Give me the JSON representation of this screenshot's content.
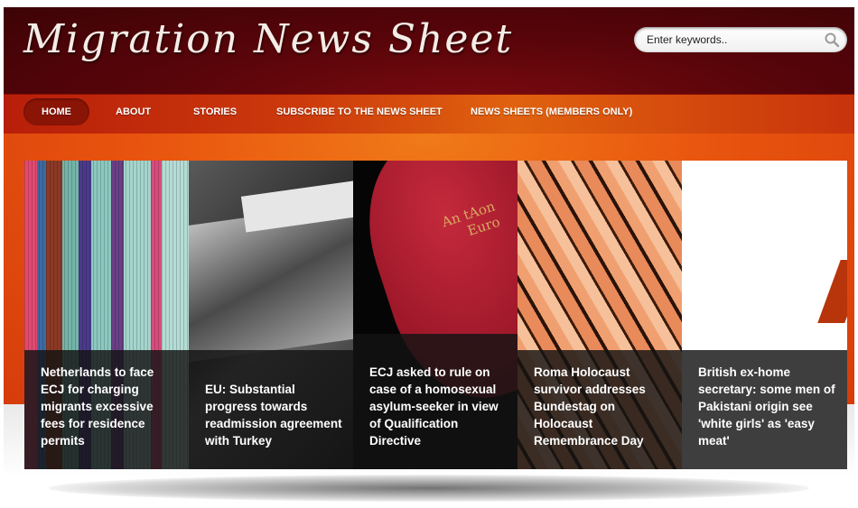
{
  "header": {
    "site_title": "Migration News Sheet",
    "search_placeholder": "Enter keywords.."
  },
  "nav": {
    "items": [
      {
        "label": "HOME",
        "active": true
      },
      {
        "label": "ABOUT",
        "active": false
      },
      {
        "label": "STORIES",
        "active": false
      },
      {
        "label": "SUBSCRIBE TO THE NEWS SHEET",
        "active": false
      },
      {
        "label": "NEWS SHEETS (MEMBERS ONLY)",
        "active": false
      }
    ]
  },
  "slider": {
    "slides": [
      {
        "caption": "Netherlands to face ECJ for charging migrants excessive fees for residence permits",
        "image": "woven-rug"
      },
      {
        "caption": "EU: Substantial progress towards readmission agreement with Turkey",
        "image": "newspaper"
      },
      {
        "caption": "ECJ asked to rule on case of a homosexual asylum-seeker in view of Qualification Directive",
        "image": "red-book",
        "book_text_1": "An tAon",
        "book_text_2": "Euro"
      },
      {
        "caption": "Roma Holocaust survivor addresses Bundestag on Holocaust Remembrance Day",
        "image": "fan-stripes"
      },
      {
        "caption": "British ex-home secretary: some men of Pakistani origin see 'white girls' as 'easy meat'",
        "image": "white"
      }
    ]
  },
  "colors": {
    "header_bg": "#5a050a",
    "nav_bg": "#cc3a0c",
    "band_bg": "#e9560f",
    "caption_bg": "#141414"
  },
  "icons": {
    "search": "magnifier-icon"
  }
}
